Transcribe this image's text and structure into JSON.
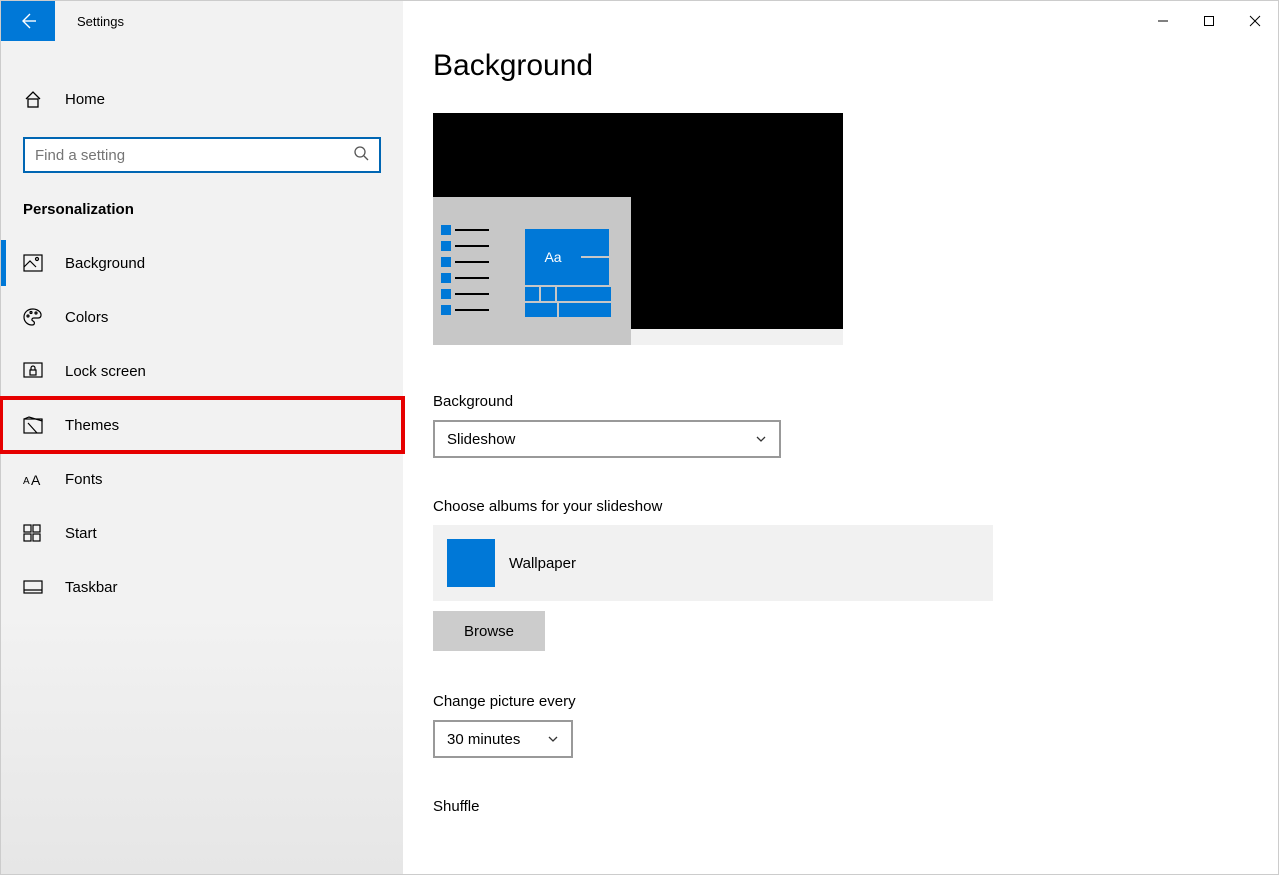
{
  "window": {
    "title": "Settings"
  },
  "sidebar": {
    "home_label": "Home",
    "search_placeholder": "Find a setting",
    "section_title": "Personalization",
    "items": [
      {
        "label": "Background"
      },
      {
        "label": "Colors"
      },
      {
        "label": "Lock screen"
      },
      {
        "label": "Themes"
      },
      {
        "label": "Fonts"
      },
      {
        "label": "Start"
      },
      {
        "label": "Taskbar"
      }
    ]
  },
  "main": {
    "title": "Background",
    "preview_sample": "Aa",
    "bg_label": "Background",
    "bg_value": "Slideshow",
    "albums_label": "Choose albums for your slideshow",
    "album_name": "Wallpaper",
    "browse_label": "Browse",
    "interval_label": "Change picture every",
    "interval_value": "30 minutes",
    "shuffle_label": "Shuffle"
  }
}
